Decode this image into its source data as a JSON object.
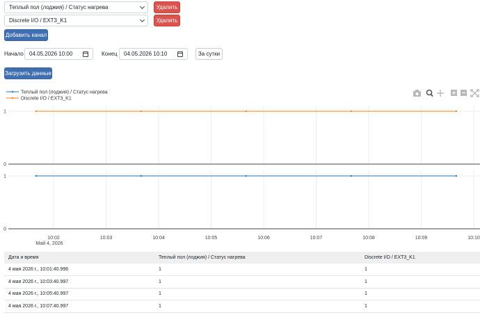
{
  "channels": [
    {
      "name": "Теплый пол (лоджия) / Статус нагрева",
      "delete_label": "Удалить"
    },
    {
      "name": "Discrete I/O / EXT3_K1",
      "delete_label": "Удалить"
    }
  ],
  "add_channel_label": "Добавить канал",
  "range": {
    "start_label": "Начало",
    "start_value": "04.05.2026 10:00",
    "end_label": "Конец",
    "end_value": "04.05.2026 10:10",
    "day_button": "За сутки"
  },
  "load_label": "Загрузить данные",
  "chart_data": {
    "type": "line",
    "layout": "two stacked subplots sharing x-axis",
    "legend_placement": "top-left",
    "x_tick_labels": [
      "10:02",
      "10:03",
      "10:04",
      "10:05",
      "10:06",
      "10:07",
      "10:08",
      "10:09",
      "10:10"
    ],
    "x_tick_date": "Май 4, 2026",
    "x": [
      "10:01:40",
      "10:03:40",
      "10:05:40",
      "10:07:40",
      "10:09:40"
    ],
    "series": [
      {
        "name": "Теплый пол (лоджия) / Статус нагрева",
        "color": "#1f77b4",
        "subplot": "bottom",
        "values": [
          1,
          1,
          1,
          1,
          1
        ],
        "ylim": [
          0,
          1
        ],
        "y_ticks": [
          "0",
          "1"
        ]
      },
      {
        "name": "Discrete I/O / EXT3_K1",
        "color": "#ff7f0e",
        "subplot": "top",
        "values": [
          1,
          1,
          1,
          1,
          1
        ],
        "ylim": [
          0,
          1
        ],
        "y_ticks": [
          "0",
          "1"
        ]
      }
    ],
    "grid": true
  },
  "modebar_icons": [
    "camera-icon",
    "zoom-icon",
    "pan-icon",
    "zoom-in-icon",
    "zoom-out-icon",
    "autoscale-icon"
  ],
  "table": {
    "headers": [
      "Дата и время",
      "Теплый пол (лоджия) / Статус нагрева",
      "Discrete I/O / EXT3_K1"
    ],
    "rows": [
      [
        "4 мая 2026 г., 10:01:40.996",
        "1",
        "1"
      ],
      [
        "4 мая 2026 г., 10:03:40.997",
        "1",
        "1"
      ],
      [
        "4 мая 2026 г., 10:05:40.997",
        "1",
        "1"
      ],
      [
        "4 мая 2026 г., 10:07:40.997",
        "1",
        "1"
      ]
    ]
  }
}
